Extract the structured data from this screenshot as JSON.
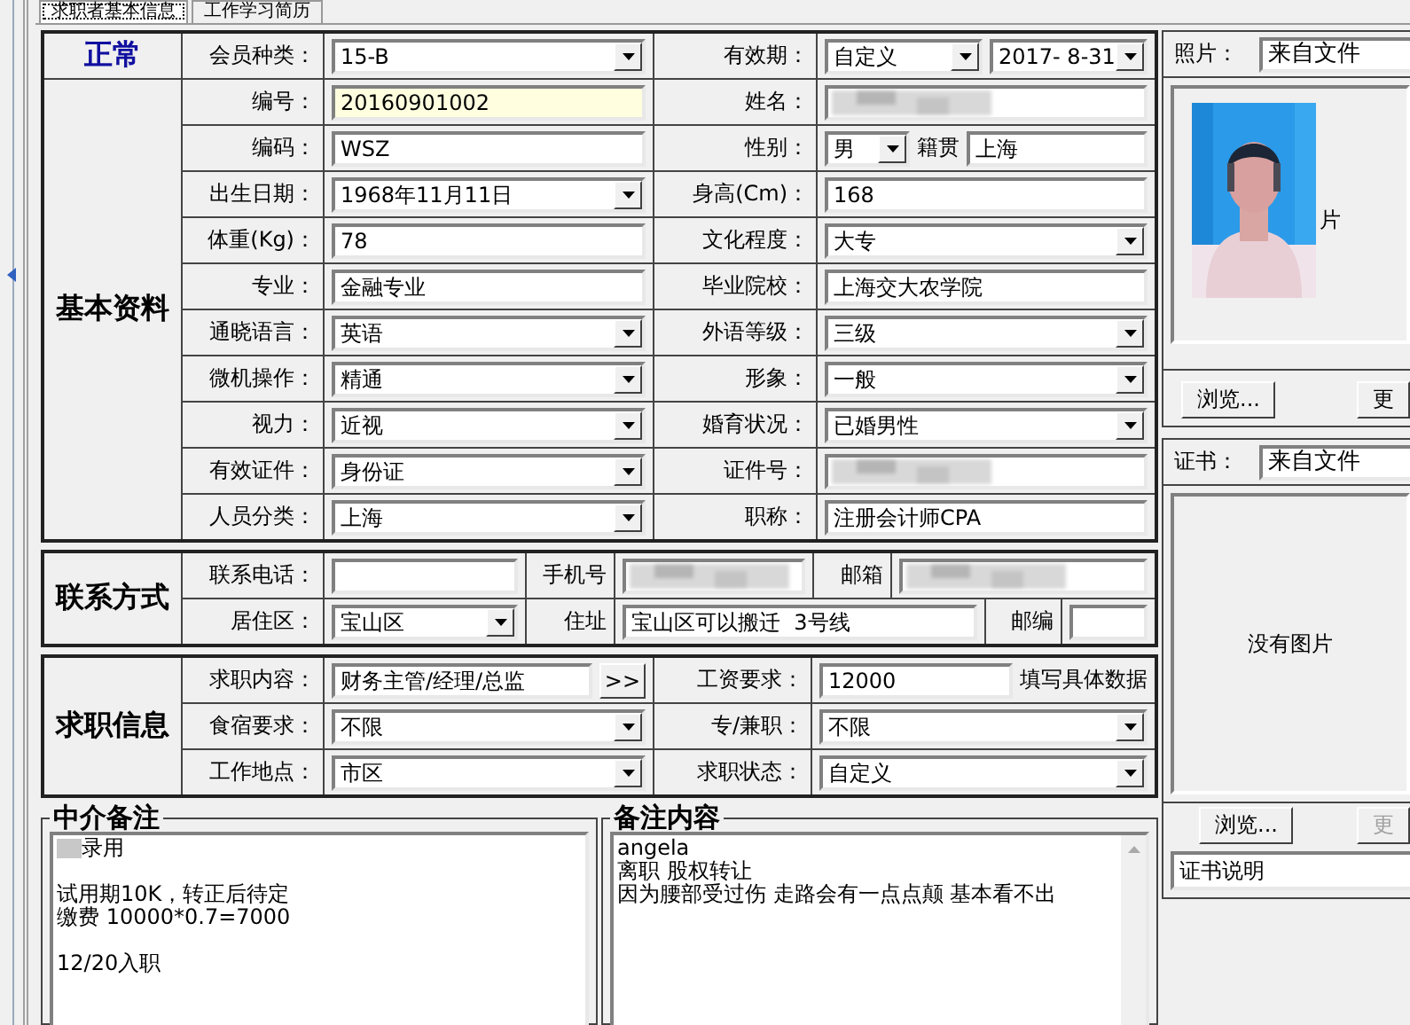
{
  "tabs": [
    {
      "label": "求职者基本信息",
      "selected": true
    },
    {
      "label": "工作学习简历",
      "selected": false
    }
  ],
  "sections": [
    {
      "status": "正常",
      "title": "基本资料",
      "rows": [
        {
          "cells": [
            {
              "kind": "label",
              "text": "会员种类："
            },
            {
              "kind": "field",
              "parts": [
                {
                  "kind": "combo",
                  "value": "15-B"
                }
              ]
            },
            {
              "kind": "label",
              "text": "有效期："
            },
            {
              "kind": "field",
              "parts": [
                {
                  "kind": "combo",
                  "value": "自定义"
                },
                {
                  "kind": "combo",
                  "value": "2017- 8-31"
                }
              ]
            }
          ]
        },
        {
          "cells": [
            {
              "kind": "label",
              "text": "编号："
            },
            {
              "kind": "field",
              "parts": [
                {
                  "kind": "text",
                  "value": "20160901002",
                  "highlighted": true
                }
              ]
            },
            {
              "kind": "label",
              "text": "姓名："
            },
            {
              "kind": "field",
              "parts": [
                {
                  "kind": "redacted"
                }
              ]
            }
          ]
        },
        {
          "cells": [
            {
              "kind": "label",
              "text": "编码："
            },
            {
              "kind": "field",
              "parts": [
                {
                  "kind": "text",
                  "value": "WSZ",
                  "highlighted": false
                }
              ]
            },
            {
              "kind": "label",
              "text": "性别："
            },
            {
              "kind": "field",
              "parts": [
                {
                  "kind": "combo_short",
                  "value": "男"
                },
                {
                  "kind": "caption",
                  "text": "籍贯"
                },
                {
                  "kind": "text",
                  "value": "上海",
                  "highlighted": false
                }
              ]
            }
          ]
        },
        {
          "cells": [
            {
              "kind": "label",
              "text": "出生日期："
            },
            {
              "kind": "field",
              "parts": [
                {
                  "kind": "combo",
                  "value": "1968年11月11日"
                }
              ]
            },
            {
              "kind": "label",
              "text": "身高(Cm)："
            },
            {
              "kind": "field",
              "parts": [
                {
                  "kind": "text",
                  "value": "168",
                  "highlighted": false
                }
              ]
            }
          ]
        },
        {
          "cells": [
            {
              "kind": "label",
              "text": "体重(Kg)："
            },
            {
              "kind": "field",
              "parts": [
                {
                  "kind": "text",
                  "value": "78",
                  "highlighted": false
                }
              ]
            },
            {
              "kind": "label",
              "text": "文化程度："
            },
            {
              "kind": "field",
              "parts": [
                {
                  "kind": "combo",
                  "value": "大专"
                }
              ]
            }
          ]
        },
        {
          "cells": [
            {
              "kind": "label",
              "text": "专业："
            },
            {
              "kind": "field",
              "parts": [
                {
                  "kind": "text",
                  "value": "金融专业",
                  "highlighted": false
                }
              ]
            },
            {
              "kind": "label",
              "text": "毕业院校："
            },
            {
              "kind": "field",
              "parts": [
                {
                  "kind": "text",
                  "value": "上海交大农学院",
                  "highlighted": false
                }
              ]
            }
          ]
        },
        {
          "cells": [
            {
              "kind": "label",
              "text": "通晓语言："
            },
            {
              "kind": "field",
              "parts": [
                {
                  "kind": "combo",
                  "value": "英语"
                }
              ]
            },
            {
              "kind": "label",
              "text": "外语等级："
            },
            {
              "kind": "field",
              "parts": [
                {
                  "kind": "combo",
                  "value": "三级"
                }
              ]
            }
          ]
        },
        {
          "cells": [
            {
              "kind": "label",
              "text": "微机操作："
            },
            {
              "kind": "field",
              "parts": [
                {
                  "kind": "combo",
                  "value": "精通"
                }
              ]
            },
            {
              "kind": "label",
              "text": "形象："
            },
            {
              "kind": "field",
              "parts": [
                {
                  "kind": "combo",
                  "value": "一般"
                }
              ]
            }
          ]
        },
        {
          "cells": [
            {
              "kind": "label",
              "text": "视力："
            },
            {
              "kind": "field",
              "parts": [
                {
                  "kind": "combo",
                  "value": "近视"
                }
              ]
            },
            {
              "kind": "label",
              "text": "婚育状况："
            },
            {
              "kind": "field",
              "parts": [
                {
                  "kind": "combo",
                  "value": "已婚男性"
                }
              ]
            }
          ]
        },
        {
          "cells": [
            {
              "kind": "label",
              "text": "有效证件："
            },
            {
              "kind": "field",
              "parts": [
                {
                  "kind": "combo",
                  "value": "身份证"
                }
              ]
            },
            {
              "kind": "label",
              "text": "证件号："
            },
            {
              "kind": "field",
              "parts": [
                {
                  "kind": "redacted"
                }
              ]
            }
          ]
        },
        {
          "cells": [
            {
              "kind": "label",
              "text": "人员分类："
            },
            {
              "kind": "field",
              "parts": [
                {
                  "kind": "combo",
                  "value": "上海"
                }
              ]
            },
            {
              "kind": "label",
              "text": "职称："
            },
            {
              "kind": "field",
              "parts": [
                {
                  "kind": "text",
                  "value": "注册会计师CPA",
                  "highlighted": false
                }
              ]
            }
          ]
        }
      ]
    },
    {
      "title": "联系方式",
      "rows": [
        {
          "cells": [
            {
              "kind": "label",
              "text": "联系电话："
            },
            {
              "kind": "field",
              "parts": [
                {
                  "kind": "text",
                  "highlighted": false
                }
              ]
            },
            {
              "kind": "label",
              "text": "手机号"
            },
            {
              "kind": "field",
              "parts": [
                {
                  "kind": "redacted"
                }
              ]
            },
            {
              "kind": "label",
              "text": "邮箱"
            },
            {
              "kind": "field",
              "parts": [
                {
                  "kind": "redacted"
                }
              ]
            }
          ]
        },
        {
          "cells": [
            {
              "kind": "label",
              "text": "居住区："
            },
            {
              "kind": "field",
              "parts": [
                {
                  "kind": "combo",
                  "value": "宝山区"
                }
              ]
            },
            {
              "kind": "label",
              "text": "住址"
            },
            {
              "kind": "field",
              "parts": [
                {
                  "kind": "text",
                  "value": "宝山区可以搬迁  3号线",
                  "highlighted": false
                }
              ]
            },
            {
              "kind": "label",
              "text": "邮编"
            },
            {
              "kind": "field",
              "parts": [
                {
                  "kind": "text",
                  "highlighted": false
                }
              ]
            }
          ]
        }
      ]
    },
    {
      "title": "求职信息",
      "rows": [
        {
          "cells": [
            {
              "kind": "label",
              "text": "求职内容："
            },
            {
              "kind": "field",
              "parts": [
                {
                  "kind": "text",
                  "value": "财务主管/经理/总监",
                  "highlighted": false
                },
                {
                  "kind": "button",
                  "label": ">>"
                }
              ]
            },
            {
              "kind": "label",
              "text": "工资要求："
            },
            {
              "kind": "field",
              "parts": [
                {
                  "kind": "text",
                  "value": "12000",
                  "highlighted": false
                },
                {
                  "kind": "caption",
                  "text": "填写具体数据"
                }
              ]
            }
          ]
        },
        {
          "cells": [
            {
              "kind": "label",
              "text": "食宿要求："
            },
            {
              "kind": "field",
              "parts": [
                {
                  "kind": "combo",
                  "value": "不限"
                }
              ]
            },
            {
              "kind": "label",
              "text": "专/兼职："
            },
            {
              "kind": "field",
              "parts": [
                {
                  "kind": "combo",
                  "value": "不限"
                }
              ]
            }
          ]
        },
        {
          "cells": [
            {
              "kind": "label",
              "text": "工作地点："
            },
            {
              "kind": "field",
              "parts": [
                {
                  "kind": "combo",
                  "value": "市区"
                }
              ]
            },
            {
              "kind": "label",
              "text": "求职状态："
            },
            {
              "kind": "field",
              "parts": [
                {
                  "kind": "combo",
                  "value": "自定义"
                }
              ]
            }
          ]
        }
      ]
    }
  ],
  "notes": [
    {
      "title": "中介备注",
      "redacted_prefix": true,
      "scrollbar": false,
      "paragraphs": [
        [
          "录用"
        ],
        [
          "试用期10K，转正后待定",
          "缴费 10000*0.7=7000"
        ],
        [
          "12/20入职"
        ]
      ]
    },
    {
      "title": "备注内容",
      "redacted_prefix": false,
      "scrollbar": true,
      "paragraphs": [
        [
          "angela",
          "离职 股权转让",
          "因为腰部受过伤 走路会有一点点颠 基本看不出"
        ]
      ]
    }
  ],
  "photo": {
    "label": "照片：",
    "source": "来自文件",
    "covered_text": "片",
    "buttons": [
      {
        "label": "浏览...",
        "disabled": false
      },
      {
        "label": "更",
        "disabled": false
      }
    ]
  },
  "certificate": {
    "label": "证书：",
    "source": "来自文件",
    "empty_text": "没有图片",
    "buttons": [
      {
        "label": "浏览...",
        "disabled": false
      },
      {
        "label": "更",
        "disabled": true
      }
    ],
    "caption": "证书说明"
  }
}
